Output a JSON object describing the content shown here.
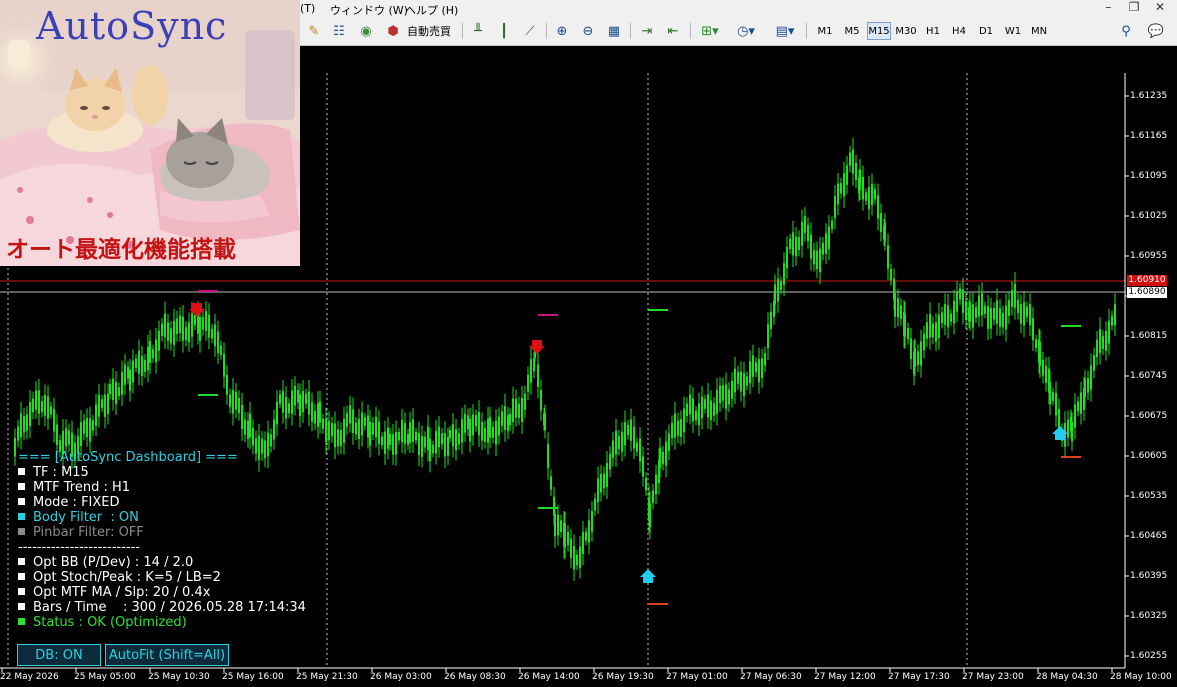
{
  "menu": {
    "item1": "(T)",
    "item2": "ウィンドウ (W)",
    "item3": "ヘルプ (H)"
  },
  "window_controls": {
    "minimize": "–",
    "restore": "❐",
    "close": "✕"
  },
  "toolbar": {
    "auto_trade_label": "自動売買",
    "timeframes": [
      "M1",
      "M5",
      "M15",
      "M30",
      "H1",
      "H4",
      "D1",
      "W1",
      "MN"
    ],
    "selected_timeframe": "M15"
  },
  "logo": {
    "title": "AutoSync",
    "caption": "オート最適化機能搭載"
  },
  "dashboard": {
    "header": "=== [AutoSync Dashboard] ===",
    "tf": "TF : M15",
    "mtf_trend": "MTF Trend : H1",
    "mode": "Mode : FIXED",
    "body_filter": "Body Filter  : ON",
    "pinbar_filter": "Pinbar Filter: OFF",
    "divider": "--------------------------",
    "opt_bb": "Opt BB (P/Dev) : 14 / 2.0",
    "opt_stoch": "Opt Stoch/Peak : K=5 / LB=2",
    "opt_mtf": "Opt MTF MA / Slp: 20 / 0.4x",
    "bars_time": "Bars / Time    : 300 / 2026.05.28 17:14:34",
    "status": "Status : OK (Optimized)"
  },
  "buttons": {
    "db": "DB: ON",
    "autofit": "AutoFit (Shift=All)"
  },
  "price_axis": [
    "1.61235",
    "1.61165",
    "1.61095",
    "1.61025",
    "1.60955",
    "1.60885",
    "1.60815",
    "1.60745",
    "1.60675",
    "1.60605",
    "1.60535",
    "1.60465",
    "1.60395",
    "1.60325",
    "1.60255"
  ],
  "current_price_red": "1.60910",
  "current_price_white": "1.60890",
  "time_axis": [
    "22 May 2026",
    "25 May 05:00",
    "25 May 10:30",
    "25 May 16:00",
    "25 May 21:30",
    "26 May 03:00",
    "26 May 08:30",
    "26 May 14:00",
    "26 May 19:30",
    "27 May 01:00",
    "27 May 06:30",
    "27 May 12:00",
    "27 May 17:30",
    "27 May 23:00",
    "28 May 04:30",
    "28 May 10:00"
  ],
  "colors": {
    "candle": "#22dd22",
    "background": "#000000",
    "sell_arrow": "#dd1111",
    "buy_arrow": "#22ccee",
    "accent": "#2ed0e0"
  },
  "signals": {
    "sell_arrow_icon": "down-arrow",
    "buy_arrow_icon": "up-arrow"
  }
}
